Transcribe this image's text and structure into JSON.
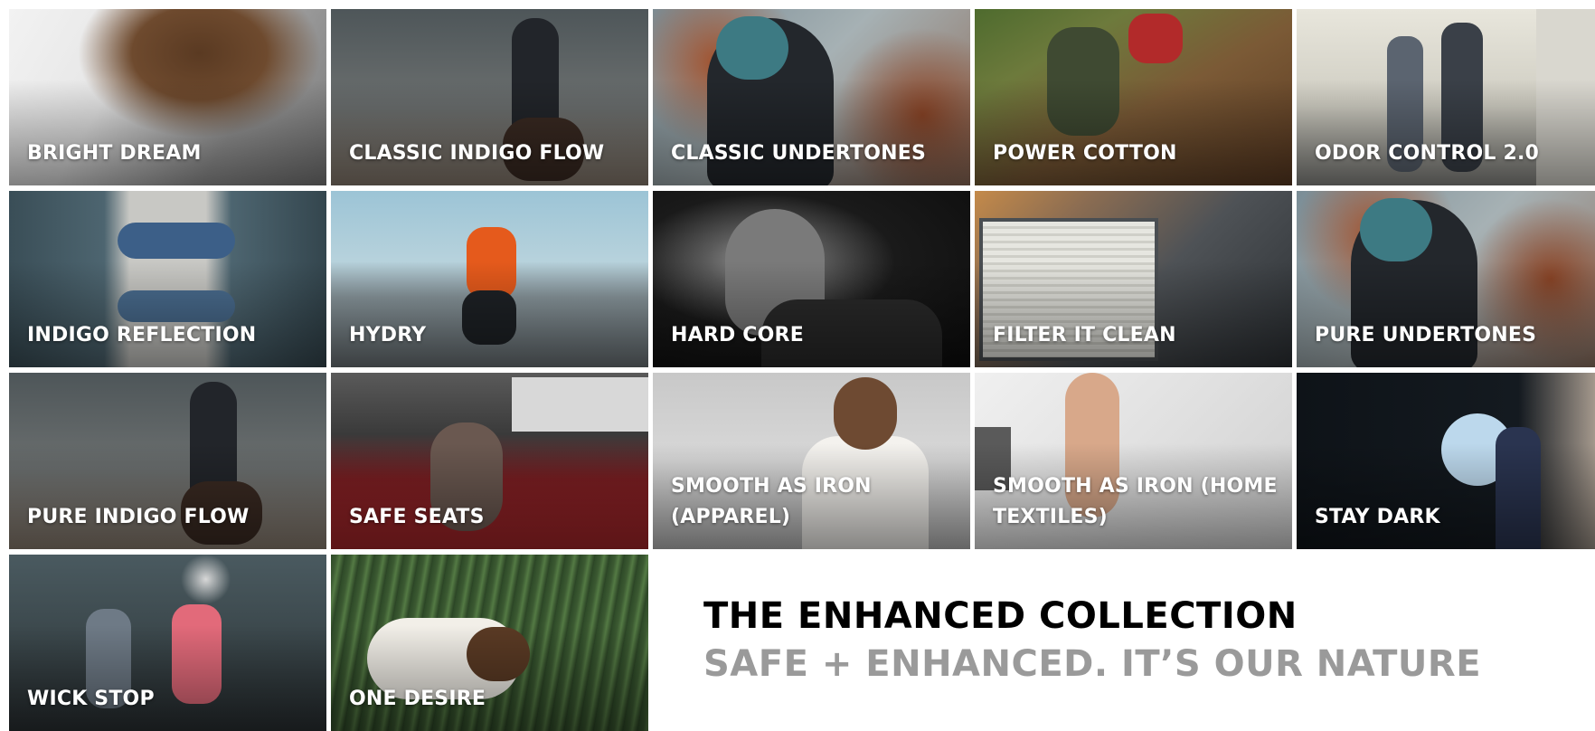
{
  "tiles": [
    {
      "label": "BRIGHT DREAM"
    },
    {
      "label": "CLASSIC INDIGO FLOW"
    },
    {
      "label": "CLASSIC UNDERTONES"
    },
    {
      "label": "POWER COTTON"
    },
    {
      "label": "ODOR CONTROL 2.0"
    },
    {
      "label": "INDIGO REFLECTION"
    },
    {
      "label": "HYDRY"
    },
    {
      "label": "HARD CORE"
    },
    {
      "label": "FILTER IT CLEAN"
    },
    {
      "label": "PURE UNDERTONES"
    },
    {
      "label": "PURE INDIGO FLOW"
    },
    {
      "label": "SAFE SEATS"
    },
    {
      "label": "SMOOTH AS IRON (APPAREL)"
    },
    {
      "label": "SMOOTH AS IRON (HOME TEXTILES)"
    },
    {
      "label": "STAY DARK"
    },
    {
      "label": "WICK STOP"
    },
    {
      "label": "ONE DESIRE"
    }
  ],
  "collection": {
    "title": "THE ENHANCED COLLECTION",
    "subtitle": "SAFE + ENHANCED. IT’S OUR NATURE"
  },
  "colors": {
    "title": "#000000",
    "subtitle": "#9a9a9a",
    "label": "#ffffff"
  }
}
